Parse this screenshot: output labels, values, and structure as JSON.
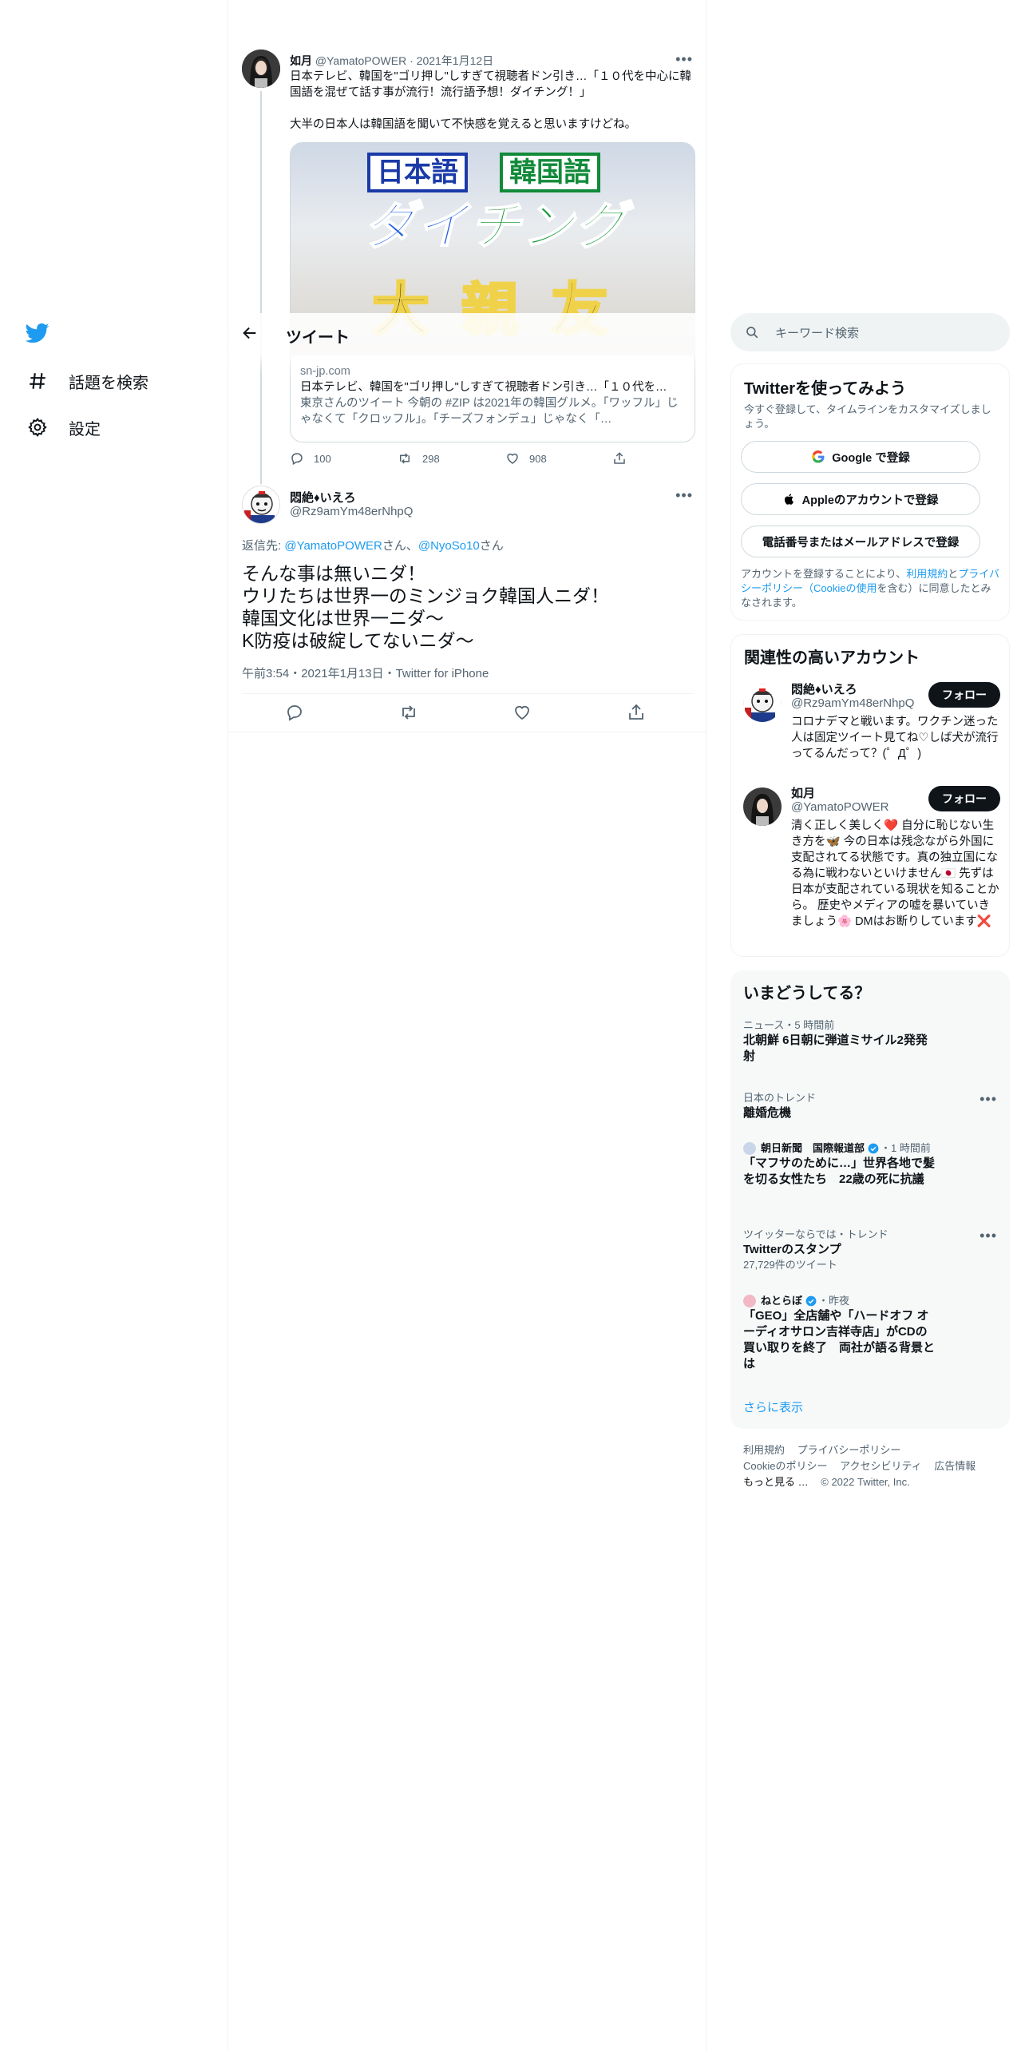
{
  "nav": {
    "explore_label": "話題を検索",
    "settings_label": "設定"
  },
  "header": {
    "title": "ツイート"
  },
  "parent_tweet": {
    "name": "如月",
    "handle": "@YamatoPOWER",
    "date": "2021年1月12日",
    "text": "日本テレビ、韓国を\"ゴリ押し\"しすぎて視聴者ドン引き…「１０代を中心に韓国語を混ぜて話す事が流行！流行語予想！ダイチング！」",
    "text2": "大半の日本人は韓国語を聞いて不快感を覚えると思いますけどね。",
    "card": {
      "image_text_ja": "日本語",
      "image_text_kr": "韓国語",
      "image_title_a": "ダイ",
      "image_title_b": "チング",
      "image_subtitle": "大親友",
      "domain": "sn-jp.com",
      "title": "日本テレビ、韓国を\"ゴリ押し\"しすぎて視聴者ドン引き…「１０代を…",
      "description": "東京さんのツイート 今朝の #ZIP は2021年の韓国グルメ。「ワッフル」じゃなくて「クロッフル」。「チーズフォンデュ」じゃなく「…"
    },
    "replies": "100",
    "retweets": "298",
    "likes": "908"
  },
  "reply_tweet": {
    "name": "悶絶♦いえろ",
    "handle": "@Rz9amYm48erNhpQ",
    "reply_to_prefix": "返信先: ",
    "reply_to_user1": "@YamatoPOWER",
    "reply_to_mid": "さん、",
    "reply_to_user2": "@NyoSo10",
    "reply_to_suffix": "さん",
    "line1": "そんな事は無いニダ！",
    "line2": "ウリたちは世界一のミンジョク韓国人ニダ！",
    "line3": "韓国文化は世界一ニダ〜",
    "line4": "K防疫は破綻してないニダ〜",
    "meta": "午前3:54・2021年1月13日・Twitter for iPhone"
  },
  "search": {
    "placeholder": "キーワード検索"
  },
  "signup": {
    "title": "Twitterを使ってみよう",
    "subtitle": "今すぐ登録して、タイムラインをカスタマイズしましょう。",
    "google_label": "Google で登録",
    "apple_label": "Appleのアカウントで登録",
    "phone_label": "電話番号またはメールアドレスで登録",
    "terms_prefix": "アカウントを登録することにより、",
    "terms_link1": "利用規約",
    "terms_and": "と",
    "terms_link2": "プライバシーポリシー",
    "terms_paren_open": "（",
    "terms_link3": "Cookieの使用",
    "terms_suffix": "を含む）に同意したとみなされます。"
  },
  "related": {
    "title": "関連性の高いアカウント",
    "follow_label": "フォロー",
    "users": [
      {
        "name": "悶絶♦いえろ",
        "handle": "@Rz9amYm48erNhpQ",
        "bio": "コロナデマと戦います。ワクチン迷った人は固定ツイート見てね♡しば犬が流行ってるんだって？(゜Д゜)"
      },
      {
        "name": "如月",
        "handle": "@YamatoPOWER",
        "bio": "清く正しく美しく❤️ 自分に恥じない生き方を🦋 今の日本は残念ながら外国に支配されてる状態です。真の独立国になる為に戦わないといけません🇯🇵 先ずは日本が支配されている現状を知ることから。 歴史やメディアの嘘を暴いていきましょう🌸 DMはお断りしています❌"
      }
    ]
  },
  "trends": {
    "title": "いまどうしてる？",
    "show_more": "さらに表示",
    "items": [
      {
        "context": "ニュース・5 時間前",
        "title": "北朝鮮 6日朝に弾道ミサイル2発発射"
      },
      {
        "context": "日本のトレンド",
        "title": "離婚危機"
      },
      {
        "source": "朝日新聞　国際報道部",
        "time": "・1 時間前",
        "title": "「マフサのために…」世界各地で髪を切る女性たち　22歳の死に抗議"
      },
      {
        "context": "ツイッターならでは・トレンド",
        "title": "Twitterのスタンプ",
        "meta": "27,729件のツイート"
      },
      {
        "source": "ねとらぼ",
        "time": "・昨夜",
        "title": "「GEO」全店舗や「ハードオフ オーディオサロン吉祥寺店」がCDの買い取りを終了　両社が語る背景とは"
      }
    ]
  },
  "footer": {
    "terms": "利用規約",
    "privacy": "プライバシーポリシー",
    "cookie": "Cookieのポリシー",
    "accessibility": "アクセシビリティ",
    "ads": "広告情報",
    "more": "もっと見る …",
    "copyright": "© 2022 Twitter, Inc."
  },
  "colors": {
    "accent": "#1d9bf0",
    "text": "#0f1419",
    "muted": "#536471",
    "border": "#eff3f4"
  }
}
